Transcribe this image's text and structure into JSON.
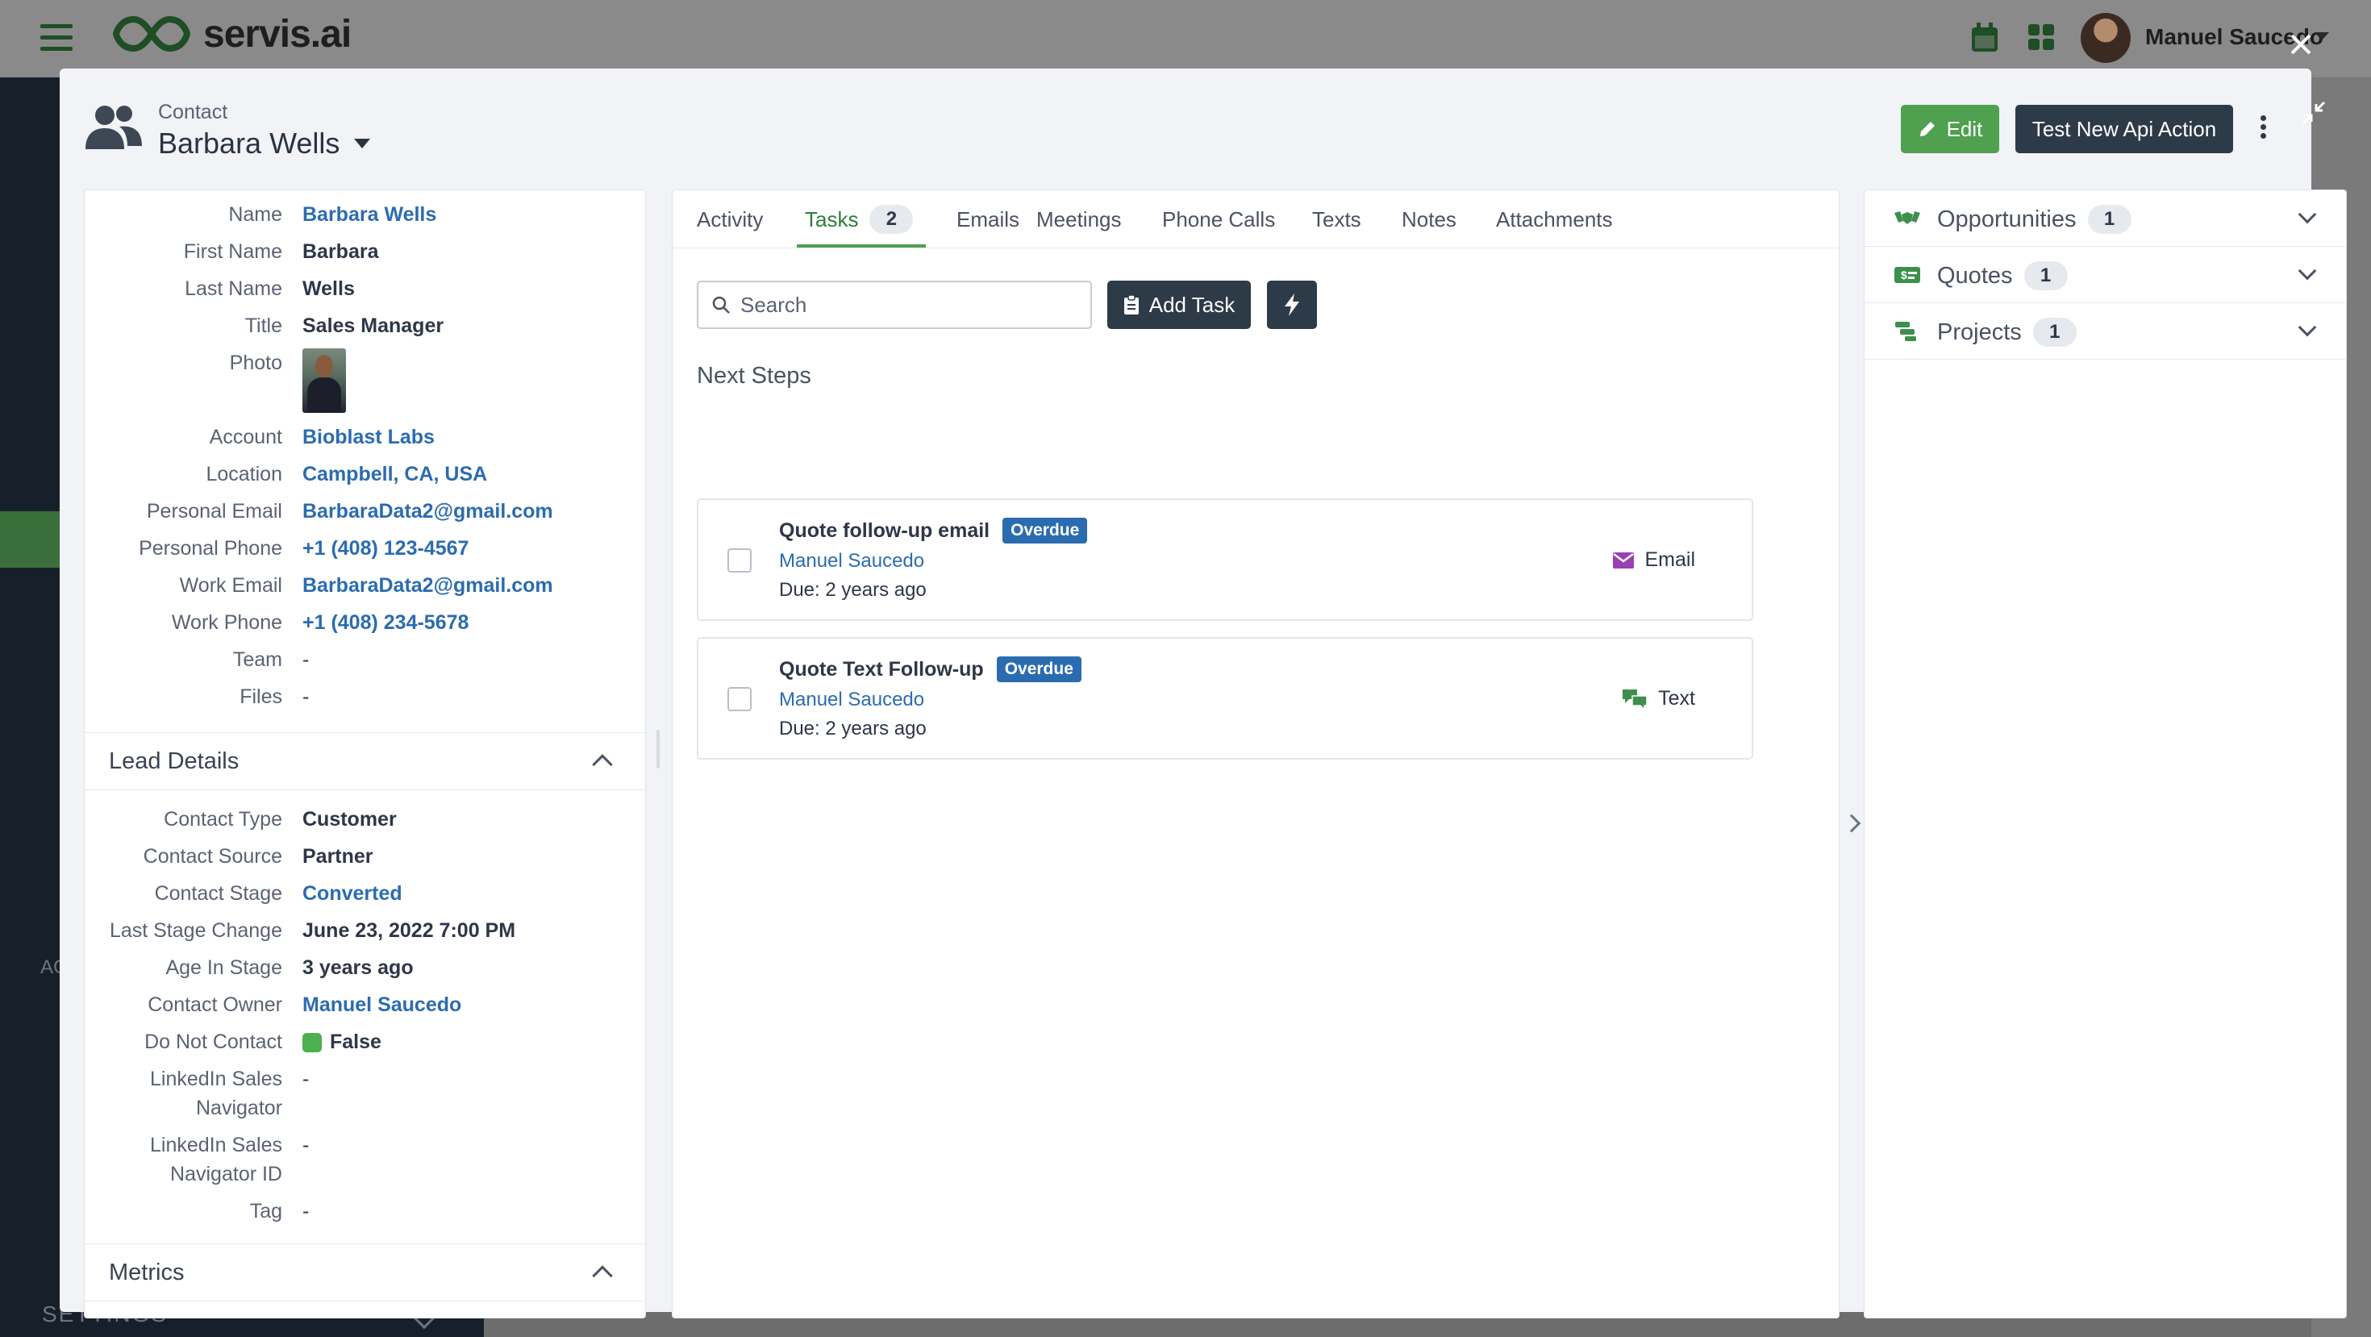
{
  "app": {
    "brand": "servis.ai",
    "user_name": "Manuel Saucedo",
    "sidebar_settings": "SETTINGS",
    "sidebar_section": "AC"
  },
  "header": {
    "kind": "Contact",
    "name": "Barbara Wells",
    "edit_label": "Edit",
    "api_action_label": "Test New Api Action"
  },
  "details": {
    "fields": [
      {
        "label": "Name",
        "value": "Barbara Wells"
      },
      {
        "label": "First Name",
        "value": "Barbara"
      },
      {
        "label": "Last Name",
        "value": "Wells"
      },
      {
        "label": "Title",
        "value": "Sales Manager"
      },
      {
        "label": "Photo",
        "value": ""
      },
      {
        "label": "Account",
        "value": "Bioblast Labs"
      },
      {
        "label": "Location",
        "value": "Campbell, CA, USA"
      },
      {
        "label": "Personal Email",
        "value": "BarbaraData2@gmail.com"
      },
      {
        "label": "Personal Phone",
        "value": "+1 (408) 123-4567"
      },
      {
        "label": "Work Email",
        "value": "BarbaraData2@gmail.com"
      },
      {
        "label": "Work Phone",
        "value": "+1 (408) 234-5678"
      },
      {
        "label": "Team",
        "value": "-"
      },
      {
        "label": "Files",
        "value": "-"
      }
    ],
    "lead_section_title": "Lead Details",
    "lead_fields": [
      {
        "label": "Contact Type",
        "value": "Customer"
      },
      {
        "label": "Contact Source",
        "value": "Partner"
      },
      {
        "label": "Contact Stage",
        "value": "Converted"
      },
      {
        "label": "Last Stage Change",
        "value": "June 23, 2022 7:00 PM"
      },
      {
        "label": "Age In Stage",
        "value": "3 years ago"
      },
      {
        "label": "Contact Owner",
        "value": "Manuel Saucedo"
      },
      {
        "label": "Do Not Contact",
        "value": "False"
      },
      {
        "label": "LinkedIn Sales",
        "label2": "Navigator",
        "value": "-"
      },
      {
        "label": "LinkedIn Sales",
        "label2": "Navigator ID",
        "value": "-"
      },
      {
        "label": "Tag",
        "value": "-"
      }
    ],
    "metrics_section_title": "Metrics"
  },
  "tabs": [
    {
      "label": "Activity"
    },
    {
      "label": "Tasks",
      "count": "2"
    },
    {
      "label": "Emails"
    },
    {
      "label": "Meetings"
    },
    {
      "label": "Phone Calls"
    },
    {
      "label": "Texts"
    },
    {
      "label": "Notes"
    },
    {
      "label": "Attachments"
    }
  ],
  "tasks_panel": {
    "search_placeholder": "Search",
    "add_task_label": "Add Task",
    "next_steps_title": "Next Steps",
    "tasks": [
      {
        "title": "Quote follow-up email",
        "status": "Overdue",
        "owner": "Manuel Saucedo",
        "due": "Due: 2 years ago",
        "type": "Email"
      },
      {
        "title": "Quote Text Follow-up",
        "status": "Overdue",
        "owner": "Manuel Saucedo",
        "due": "Due: 2 years ago",
        "type": "Text"
      }
    ]
  },
  "related": [
    {
      "label": "Opportunities",
      "count": "1"
    },
    {
      "label": "Quotes",
      "count": "1"
    },
    {
      "label": "Projects",
      "count": "1"
    }
  ],
  "colors": {
    "brand_green": "#4fa04f",
    "dark_button": "#2d3a48",
    "link_blue": "#2b6cb0",
    "email_purple": "#9b3fb5",
    "text_green": "#3d8f4b"
  },
  "icons": {
    "header": "contacts-icon",
    "edit": "pencil-icon",
    "add_task": "clipboard-icon",
    "automation": "lightning-bolt-icon",
    "email": "envelope-icon",
    "text": "chat-bubbles-icon",
    "opportunities": "handshake-icon",
    "quotes": "money-check-icon",
    "projects": "project-diagram-icon"
  }
}
